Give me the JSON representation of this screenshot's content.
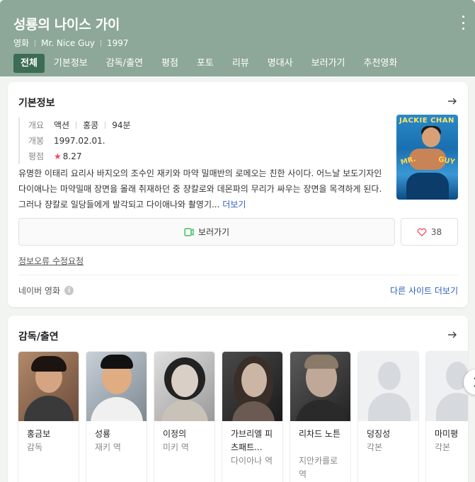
{
  "header": {
    "title": "성룡의 나이스 가이",
    "meta": [
      "영화",
      "Mr. Nice Guy",
      "1997"
    ],
    "tabs": [
      "전체",
      "기본정보",
      "감독/출연",
      "평점",
      "포토",
      "리뷰",
      "명대사",
      "보러가기",
      "추천영화"
    ],
    "active_tab": "전체"
  },
  "basic": {
    "title": "기본정보",
    "overview_label": "개요",
    "overview": [
      "액션",
      "홍콩",
      "94분"
    ],
    "release_label": "개봉",
    "release": "1997.02.01.",
    "rating_label": "평점",
    "rating": "8.27",
    "description": "유명한 이태리 요리사 바지오의 조수인 재키와 마약 밀매반의 로메오는 친한 사이다. 어느날 보도기자인 다이애나는 마약밀매 장면을 몰래 취재하던 중 쟝칼로와 데몬파의 무리가 싸우는 장면을 목격하게 된다. 그러나 쟝칼로 일당들에게 발각되고 다이애나와 촬영기...",
    "more": "더보기",
    "poster_text": {
      "top": "JACKIE CHAN",
      "left": "MR.",
      "right": "GUY"
    },
    "watch_label": "보러가기",
    "like_count": "38",
    "edit_request": "정보오류 수정요청",
    "source": "네이버 영화",
    "other_sites": "다른 사이트 더보기"
  },
  "cast": {
    "title": "감독/출연",
    "people": [
      {
        "name": "홍금보",
        "role": "감독",
        "photo": "portrait"
      },
      {
        "name": "성룡",
        "role": "재키 역",
        "photo": "portrait"
      },
      {
        "name": "이정의",
        "role": "미키 역",
        "photo": "portrait"
      },
      {
        "name": "가브리엘 피츠패트...",
        "role": "다이아나 역",
        "photo": "portrait"
      },
      {
        "name": "리차드 노튼",
        "role": "지안카를로 역",
        "photo": "portrait"
      },
      {
        "name": "덩징성",
        "role": "각본",
        "photo": "placeholder"
      },
      {
        "name": "마미평",
        "role": "각본",
        "photo": "placeholder"
      }
    ]
  },
  "colors": {
    "header_bg": "#8da898",
    "active_tab": "#3d6c55",
    "link": "#2b5fb9",
    "star": "#f04a5a",
    "watch_icon": "#3fbf5f",
    "heart": "#f04a5a"
  }
}
